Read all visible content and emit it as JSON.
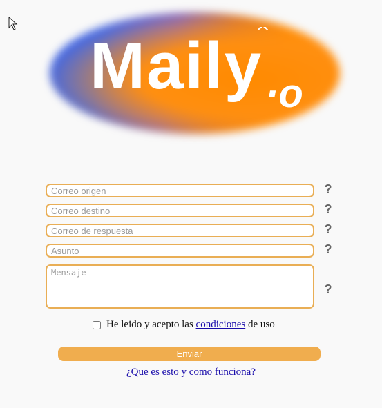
{
  "logo": {
    "text": "Maily",
    "accent": "´`",
    "suffix": "·o",
    "colors": {
      "blue": "#3f66e6",
      "orange": "#ff8c00"
    }
  },
  "form": {
    "from": {
      "placeholder": "Correo origen",
      "value": ""
    },
    "to": {
      "placeholder": "Correo destino",
      "value": ""
    },
    "reply_to": {
      "placeholder": "Correo de respuesta",
      "value": ""
    },
    "subject": {
      "placeholder": "Asunto",
      "value": ""
    },
    "message": {
      "placeholder": "Mensaje",
      "value": ""
    },
    "help_symbol": "?",
    "terms": {
      "prefix": "He leido y acepto las",
      "link": "condiciones",
      "suffix": "de uso",
      "checked": false
    },
    "submit_label": "Enviar",
    "help_link": "¿Que es esto y como funciona?"
  },
  "icons": {
    "cursor": "cursor-arrow-icon",
    "help": "question-mark-icon"
  },
  "accent_color": "#f0ad4e"
}
